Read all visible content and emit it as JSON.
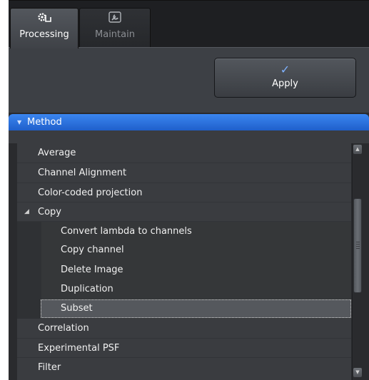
{
  "tabs": [
    {
      "label": "Processing",
      "icon": "gear-icon",
      "active": true
    },
    {
      "label": "Maintain",
      "icon": "wrench-icon",
      "active": false
    }
  ],
  "toolbar": {
    "apply_label": "Apply",
    "apply_icon": "checkmark-icon"
  },
  "section": {
    "title": "Method",
    "expanded": true
  },
  "method_list": {
    "items": [
      {
        "label": "Average",
        "level": 0
      },
      {
        "label": "Channel Alignment",
        "level": 0
      },
      {
        "label": "Color-coded projection",
        "level": 0
      },
      {
        "label": "Copy",
        "level": 0,
        "expanded": true
      },
      {
        "label": "Convert lambda to channels",
        "level": 1
      },
      {
        "label": "Copy channel",
        "level": 1
      },
      {
        "label": "Delete Image",
        "level": 1
      },
      {
        "label": "Duplication",
        "level": 1
      },
      {
        "label": "Subset",
        "level": 1,
        "selected": true
      },
      {
        "label": "Correlation",
        "level": 0
      },
      {
        "label": "Experimental PSF",
        "level": 0
      },
      {
        "label": "Filter",
        "level": 0
      }
    ]
  },
  "colors": {
    "accent": "#2a6fe0",
    "panel": "#3a3c40",
    "background": "#2a2b2e"
  }
}
